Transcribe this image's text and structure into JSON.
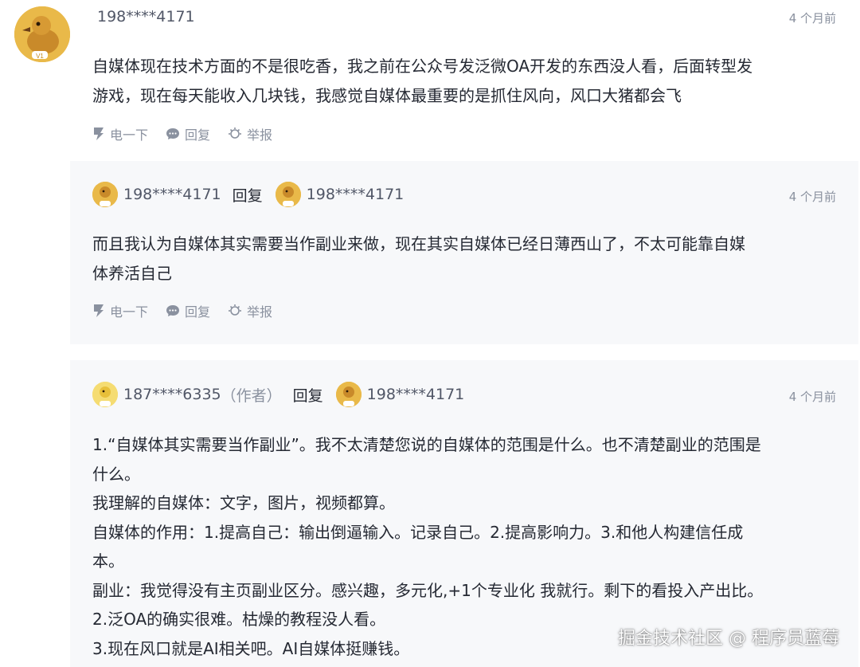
{
  "comment": {
    "username": "198****4171",
    "time": "4 个月前",
    "text_lines": [
      "自媒体现在技术方面的不是很吃香，我之前在公众号发泛微OA开发的东西没人看，后面转型发",
      "游戏，现在每天能收入几块钱，我感觉自媒体最重要的是抓住风向，风口大猪都会飞"
    ],
    "actions": {
      "like": "电一下",
      "reply": "回复",
      "report": "举报"
    },
    "avatar_icon": "duck-avatar-icon"
  },
  "reply1": {
    "from_user": "198****4171",
    "reply_word": "回复",
    "to_user": "198****4171",
    "time": "4 个月前",
    "text_lines": [
      "而且我认为自媒体其实需要当作副业来做，现在其实自媒体已经日薄西山了，不太可能靠自媒",
      "体养活自己"
    ],
    "actions": {
      "like": "电一下",
      "reply": "回复",
      "report": "举报"
    }
  },
  "reply2": {
    "from_user": "187****6335",
    "author_tag": "（作者）",
    "reply_word": "回复",
    "to_user": "198****4171",
    "time": "4 个月前",
    "text_lines": [
      "1.“自媒体其实需要当作副业”。我不太清楚您说的自媒体的范围是什么。也不清楚副业的范围是",
      "什么。",
      "我理解的自媒体：文字，图片，视频都算。",
      "自媒体的作用：1.提高自己：输出倒逼输入。记录自己。2.提高影响力。3.和他人构建信任成",
      "本。",
      "副业：我觉得没有主页副业区分。感兴趣，多元化,+1个专业化 我就行。剩下的看投入产出比。",
      "2.泛OA的确实很难。枯燥的教程没人看。",
      "3.现在风口就是AI相关吧。AI自媒体挺赚钱。"
    ]
  },
  "watermark": "掘金技术社区 @ 程序员蓝莓",
  "colors": {
    "reply_bg": "#f7f8fa",
    "meta": "#8a919f",
    "text": "#252933",
    "badge": "#e8b33a"
  }
}
